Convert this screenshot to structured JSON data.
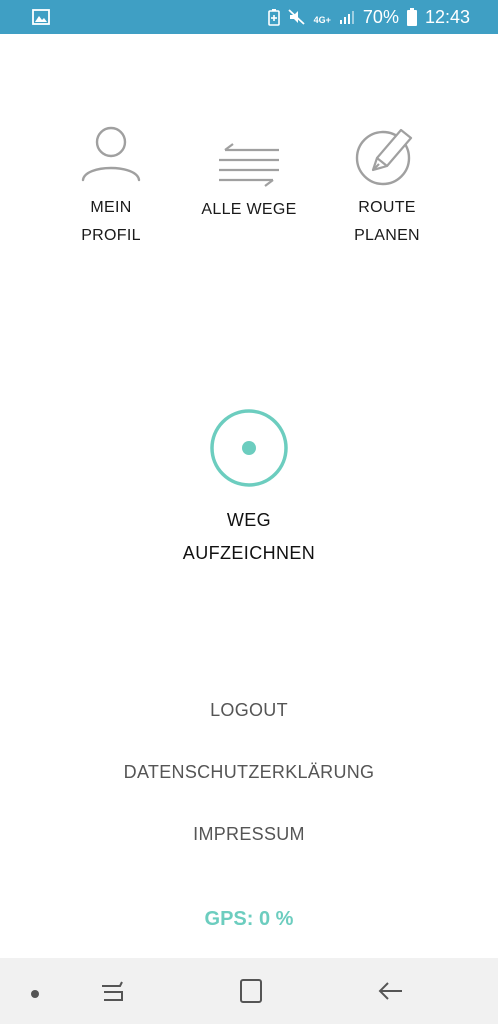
{
  "status_bar": {
    "battery": "70%",
    "time": "12:43",
    "network": "4G+",
    "icons": [
      "image-icon",
      "battery-saver-icon",
      "mute-icon",
      "network-icon",
      "signal-icon",
      "battery-icon"
    ]
  },
  "nav": {
    "profile": {
      "line1": "MEIN",
      "line2": "PROFIL",
      "icon": "user-icon"
    },
    "all_routes": {
      "label": "ALLE WEGE",
      "icon": "routes-list-icon"
    },
    "plan_route": {
      "line1": "ROUTE",
      "line2": "PLANEN",
      "icon": "pen-circle-icon"
    }
  },
  "record": {
    "line1": "WEG",
    "line2": "AUFZEICHNEN",
    "icon": "record-circle-icon"
  },
  "links": {
    "logout": "LOGOUT",
    "privacy": "DATENSCHUTZERKLÄRUNG",
    "imprint": "IMPRESSUM"
  },
  "gps_status": "GPS: 0 %",
  "colors": {
    "status_bar": "#3f9fc4",
    "accent": "#6ccdbf",
    "icon_gray": "#a0a0a0"
  },
  "system_nav": {
    "buttons": [
      "dot-icon",
      "recent-apps-icon",
      "home-icon",
      "back-icon"
    ]
  }
}
